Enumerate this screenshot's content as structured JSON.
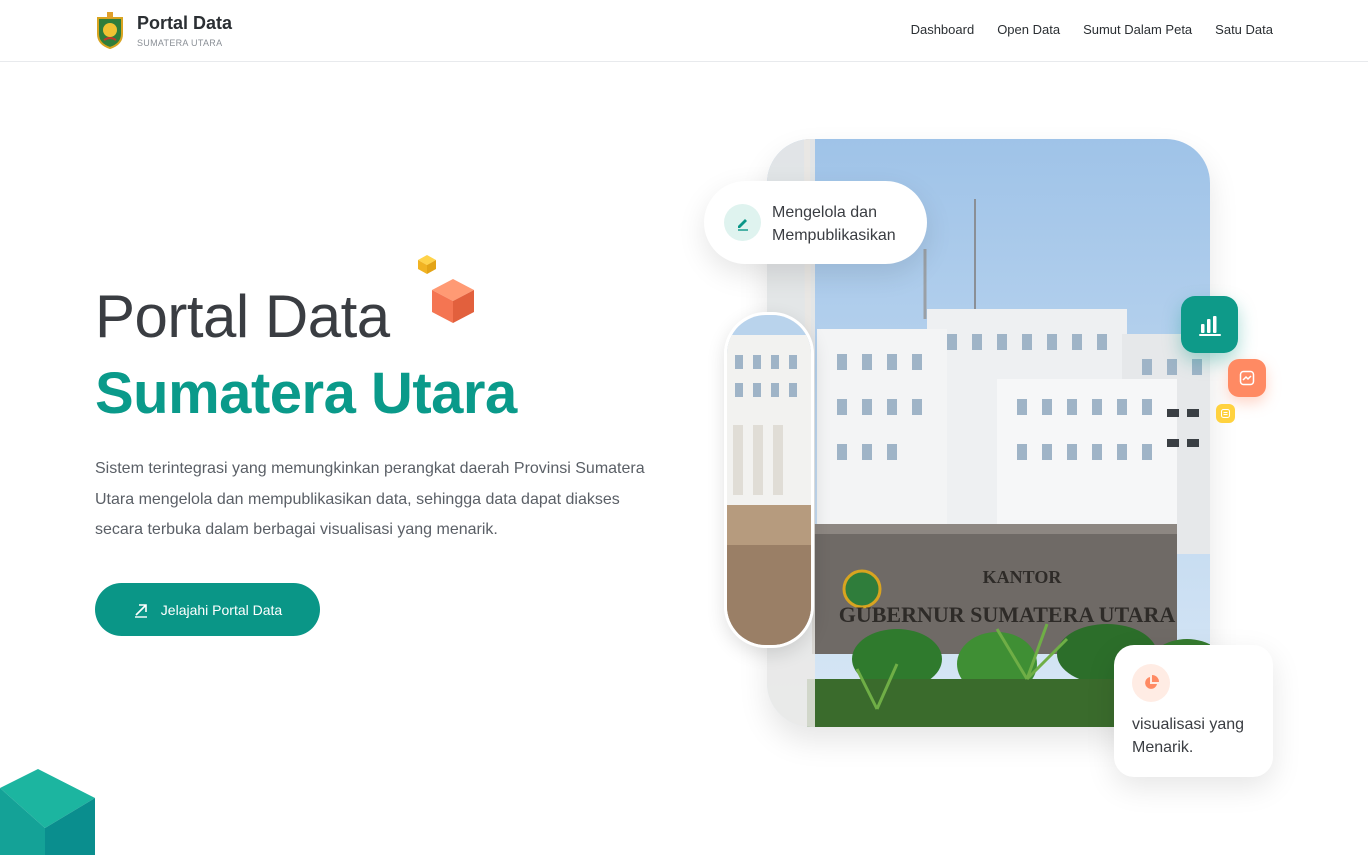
{
  "header": {
    "brand_title": "Portal Data",
    "brand_subtitle": "SUMATERA UTARA",
    "nav": [
      "Dashboard",
      "Open Data",
      "Sumut Dalam Peta",
      "Satu Data"
    ]
  },
  "hero": {
    "title_line1": "Portal Data",
    "title_line2": "Sumatera Utara",
    "description": "Sistem terintegrasi yang memungkinkan perangkat daerah Provinsi Sumatera Utara mengelola dan mempublikasikan data, sehingga data dapat diakses secara terbuka dalam berbagai visualisasi yang menarik.",
    "cta_label": "Jelajahi Portal Data"
  },
  "cards": {
    "manage_text": "Mengelola dan Mempublikasikan",
    "visual_text": "visualisasi yang Menarik."
  },
  "photo": {
    "sign_line1": "KANTOR",
    "sign_line2": "GUBERNUR SUMATERA UTARA"
  },
  "colors": {
    "primary": "#0a9687",
    "orange": "#ff8a63",
    "yellow": "#ffd23f"
  },
  "icons": [
    "edit-icon",
    "bar-chart-icon",
    "trend-icon",
    "pie-chart-icon",
    "arrow-up-right-icon"
  ]
}
